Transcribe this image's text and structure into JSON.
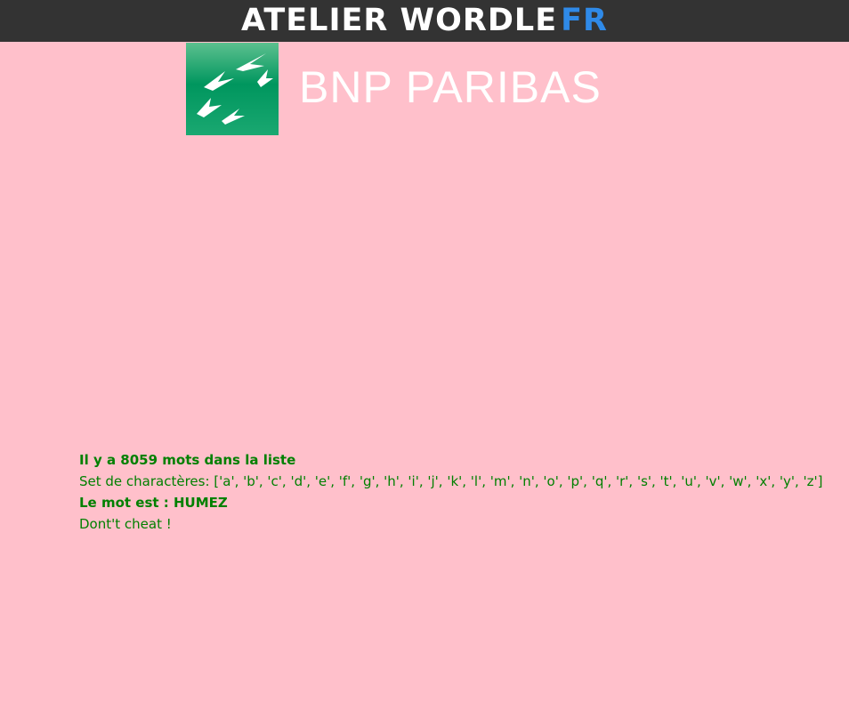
{
  "header": {
    "title_main": "ATELIER WORDLE",
    "title_accent": "FR"
  },
  "logo": {
    "text": "BNP PARIBAS",
    "icon": "bnp-stars-logo-icon"
  },
  "info": {
    "word_count": "Il y a 8059 mots dans la liste",
    "charset": "Set de charactères: ['a', 'b', 'c', 'd', 'e', 'f', 'g', 'h', 'i', 'j', 'k', 'l', 'm', 'n', 'o', 'p', 'q', 'r', 's', 't', 'u', 'v', 'w', 'x', 'y', 'z']",
    "answer": "Le mot est : HUMEZ",
    "warning": "Dont't cheat !"
  },
  "colors": {
    "background": "#ffc0cb",
    "topbar": "#333333",
    "accent": "#2f8ae8",
    "text_green": "#008000",
    "logo_green": "#00965e"
  }
}
